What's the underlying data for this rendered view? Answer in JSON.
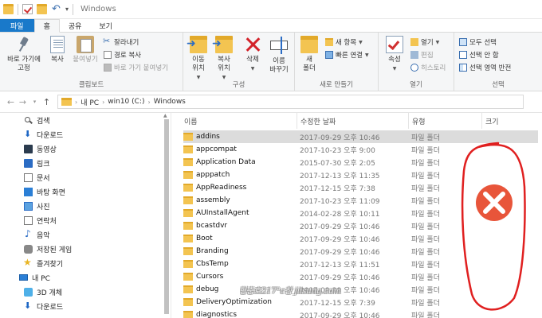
{
  "window": {
    "title": "Windows"
  },
  "tabs": [
    {
      "label": "파일"
    },
    {
      "label": "홈"
    },
    {
      "label": "공유"
    },
    {
      "label": "보기"
    }
  ],
  "ribbon": {
    "clipboard": {
      "label": "클립보드",
      "pin_line1": "바로 가기에",
      "pin_line2": "고정",
      "copy": "복사",
      "paste": "붙여넣기",
      "cut": "잘라내기",
      "copy_path": "경로 복사",
      "paste_shortcut": "바로 가기 붙여넣기"
    },
    "organize": {
      "label": "구성",
      "move_line1": "이동",
      "move_line2": "위치",
      "copyto_line1": "복사",
      "copyto_line2": "위치",
      "delete": "삭제",
      "rename_line1": "이름",
      "rename_line2": "바꾸기"
    },
    "new": {
      "label": "새로 만들기",
      "newfolder_line1": "새",
      "newfolder_line2": "폴더",
      "new_item": "새 항목",
      "easy_access": "빠른 연결"
    },
    "open": {
      "label": "열기",
      "properties": "속성",
      "open": "열기",
      "edit": "편집",
      "history": "히스토리"
    },
    "select": {
      "label": "선택",
      "select_all": "모두 선택",
      "select_none": "선택 안 함",
      "invert": "선택 영역 반전"
    }
  },
  "address": {
    "crumbs": [
      "내 PC",
      "win10 (C:)",
      "Windows"
    ]
  },
  "nav": {
    "items": [
      {
        "label": "검색",
        "icon": "search-icon"
      },
      {
        "label": "다운로드",
        "icon": "download-icon"
      },
      {
        "label": "동영상",
        "icon": "video-icon"
      },
      {
        "label": "링크",
        "icon": "link-icon"
      },
      {
        "label": "문서",
        "icon": "document-icon"
      },
      {
        "label": "바탕 화면",
        "icon": "desktop-icon"
      },
      {
        "label": "사진",
        "icon": "picture-icon"
      },
      {
        "label": "연락처",
        "icon": "contacts-icon"
      },
      {
        "label": "음악",
        "icon": "music-icon"
      },
      {
        "label": "저장된 게임",
        "icon": "saved-games-icon"
      },
      {
        "label": "즐겨찾기",
        "icon": "star-icon"
      }
    ],
    "pc": "내 PC",
    "pc_items": [
      {
        "label": "3D 개체"
      },
      {
        "label": "다운로드"
      }
    ]
  },
  "columns": {
    "name": "이름",
    "date": "수정한 날짜",
    "type": "유형",
    "size": "크기"
  },
  "files": [
    {
      "name": "addins",
      "date": "2017-09-29 오후 10:46",
      "type": "파일 폴더"
    },
    {
      "name": "appcompat",
      "date": "2017-10-23 오후 9:00",
      "type": "파일 폴더"
    },
    {
      "name": "Application Data",
      "date": "2015-07-30 오후 2:05",
      "type": "파일 폴더"
    },
    {
      "name": "apppatch",
      "date": "2017-12-13 오후 11:35",
      "type": "파일 폴더"
    },
    {
      "name": "AppReadiness",
      "date": "2017-12-15 오후 7:38",
      "type": "파일 폴더"
    },
    {
      "name": "assembly",
      "date": "2017-10-23 오후 11:09",
      "type": "파일 폴더"
    },
    {
      "name": "AUInstallAgent",
      "date": "2014-02-28 오후 10:11",
      "type": "파일 폴더"
    },
    {
      "name": "bcastdvr",
      "date": "2017-09-29 오후 10:46",
      "type": "파일 폴더"
    },
    {
      "name": "Boot",
      "date": "2017-09-29 오후 10:46",
      "type": "파일 폴더"
    },
    {
      "name": "Branding",
      "date": "2017-09-29 오후 10:46",
      "type": "파일 폴더"
    },
    {
      "name": "CbsTemp",
      "date": "2017-12-13 오후 11:51",
      "type": "파일 폴더"
    },
    {
      "name": "Cursors",
      "date": "2017-09-29 오후 10:46",
      "type": "파일 폴더"
    },
    {
      "name": "debug",
      "date": "2017-09-29 오후 10:46",
      "type": "파일 폴더"
    },
    {
      "name": "DeliveryOptimization",
      "date": "2017-12-15 오후 7:39",
      "type": "파일 폴더"
    },
    {
      "name": "diagnostics",
      "date": "2017-09-29 오후 10:46",
      "type": "파일 폴더"
    }
  ],
  "watermark": "형충호217°c창 jiisung.com",
  "colors": {
    "accent": "#1979ca",
    "annotation": "#e02020",
    "error_badge": "#e8553a"
  }
}
